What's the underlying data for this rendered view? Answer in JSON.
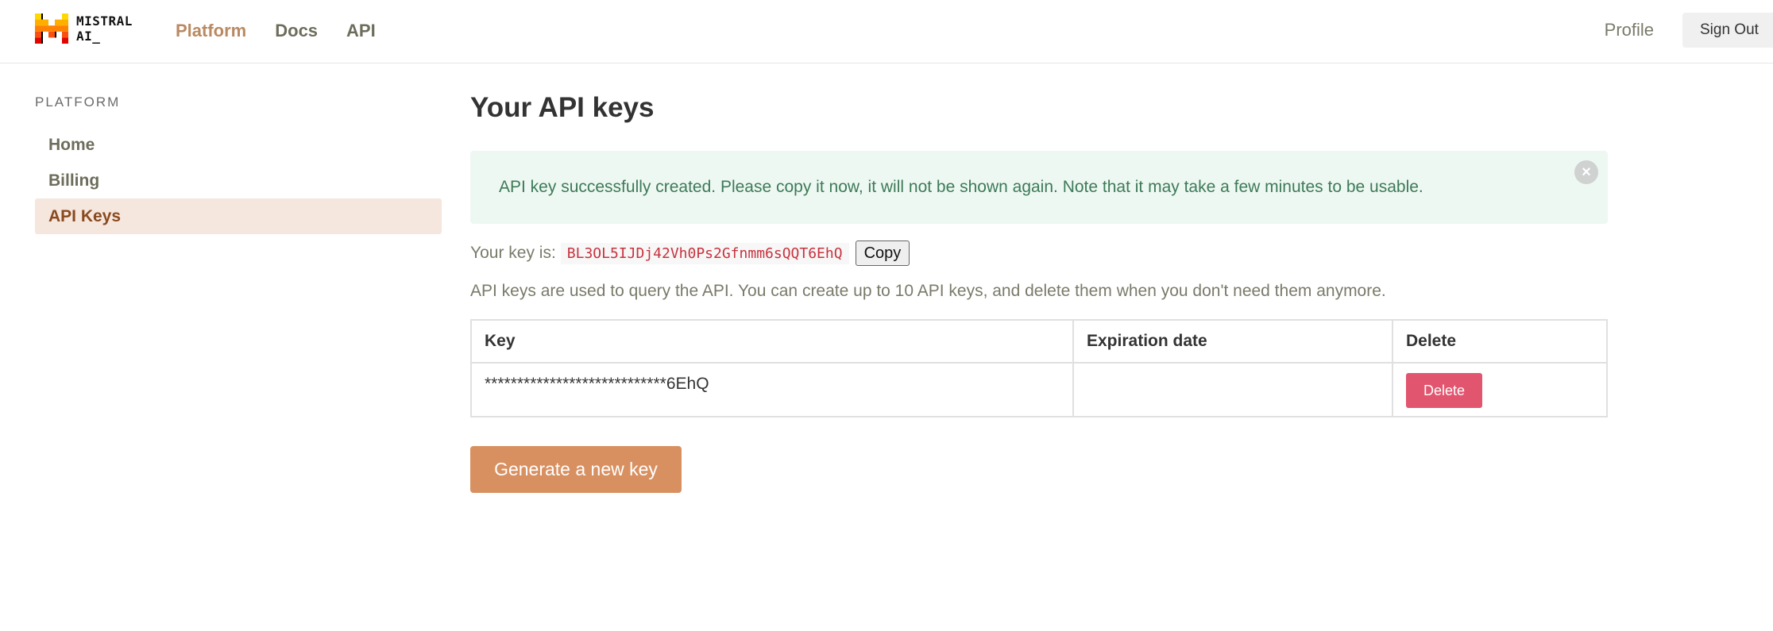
{
  "brand": {
    "name_line1": "MISTRAL",
    "name_line2": "AI_",
    "colors": [
      "#ffd800",
      "#ffaf00",
      "#ff8205",
      "#fa500f",
      "#e10500",
      "#000000"
    ]
  },
  "nav": {
    "links": [
      {
        "label": "Platform",
        "active": true
      },
      {
        "label": "Docs",
        "active": false
      },
      {
        "label": "API",
        "active": false
      }
    ],
    "profile_label": "Profile",
    "signout_label": "Sign Out"
  },
  "sidebar": {
    "heading": "PLATFORM",
    "items": [
      {
        "label": "Home",
        "active": false
      },
      {
        "label": "Billing",
        "active": false
      },
      {
        "label": "API Keys",
        "active": true
      }
    ]
  },
  "main": {
    "title": "Your API keys",
    "alert": {
      "text": "API key successfully created. Please copy it now, it will not be shown again. Note that it may take a few minutes to be usable.",
      "close_symbol": "×"
    },
    "key_prefix": "Your key is:",
    "key_value": "BL3OL5IJDj42Vh0Ps2Gfnmm6sQQT6EhQ",
    "copy_label": "Copy",
    "description": "API keys are used to query the API. You can create up to 10 API keys, and delete them when you don't need them anymore.",
    "table": {
      "headers": [
        "Key",
        "Expiration date",
        "Delete"
      ],
      "rows": [
        {
          "key": "****************************6EhQ",
          "expiration": "",
          "delete_label": "Delete"
        }
      ]
    },
    "generate_label": "Generate a new key"
  },
  "theme": {
    "accent": "#b98a62",
    "sidebar_active_bg": "#f5e6de",
    "alert_bg": "#eef8f2",
    "delete_color": "#e2556e",
    "generate_color": "#d89060"
  }
}
